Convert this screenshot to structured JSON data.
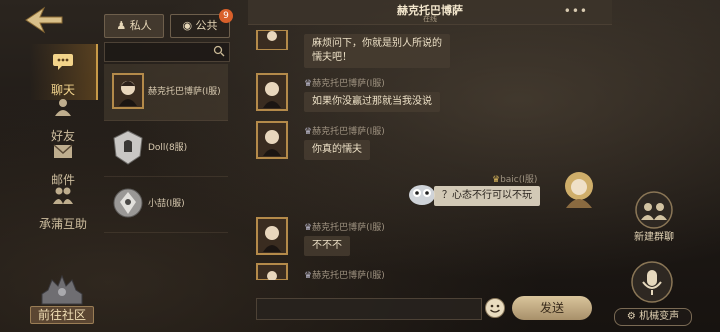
{
  "nav": {
    "items": [
      {
        "label": "聊天",
        "icon": "chat-bubble-icon",
        "active": true
      },
      {
        "label": "好友",
        "icon": "friends-icon",
        "active": false
      },
      {
        "label": "邮件",
        "icon": "mail-icon",
        "active": false
      },
      {
        "label": "承蒲互助",
        "icon": "mutual-help-icon",
        "active": false
      }
    ],
    "community_label": "前往社区"
  },
  "tabs": {
    "private": "私人",
    "public": "公共",
    "public_badge": "9"
  },
  "conversations": [
    {
      "name": "赫克托巴博萨(I服)"
    },
    {
      "name": "Doll(8服)"
    },
    {
      "name": "小喆(I服)"
    }
  ],
  "chat": {
    "title": "赫克托巴博萨",
    "status": "在线",
    "more": "•••",
    "messages": [
      {
        "sender": "",
        "text": "麻烦问下，你就是别人所说的\n懦夫吧！"
      },
      {
        "sender": "赫克托巴博萨(I服)",
        "text": "如果你没赢过那就当我没说"
      },
      {
        "sender": "赫克托巴博萨(I服)",
        "text": "你真的懦夫"
      },
      {
        "sender": "baic(I服)",
        "text": "？心态不行可以不玩",
        "self": true
      },
      {
        "sender": "赫克托巴博萨(I服)",
        "text": "不不不"
      },
      {
        "sender": "赫克托巴博萨(I服)",
        "text": ""
      }
    ],
    "send_label": "发送"
  },
  "right": {
    "new_group": "新建群聊",
    "voice_change": "机械变声"
  },
  "colors": {
    "accent": "#c89a48",
    "badge": "#d9602a"
  }
}
